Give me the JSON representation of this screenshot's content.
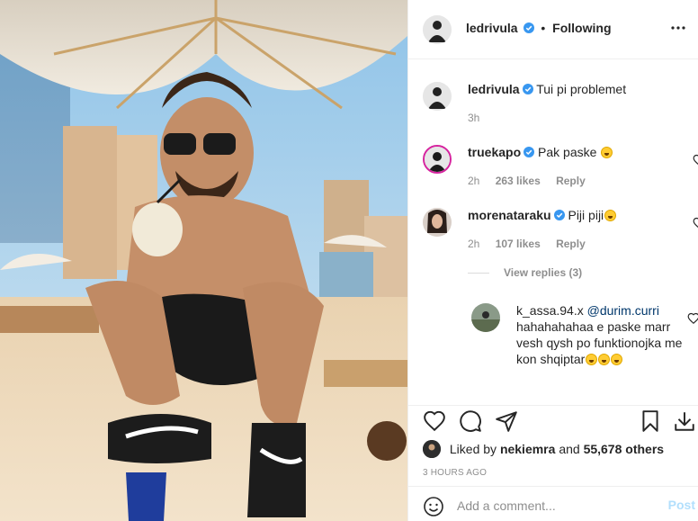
{
  "header": {
    "username": "ledrivula",
    "separator": "•",
    "follow_state": "Following"
  },
  "caption": {
    "username": "ledrivula",
    "text": "Tui pi problemet",
    "time": "3h"
  },
  "comments": [
    {
      "username": "truekapo",
      "text": "Pak paske",
      "time": "2h",
      "likes": "263 likes",
      "reply_label": "Reply"
    },
    {
      "username": "morenataraku",
      "text": "Piji piji",
      "time": "2h",
      "likes": "107 likes",
      "reply_label": "Reply"
    }
  ],
  "view_replies": "View replies (3)",
  "reply": {
    "username": "k_assa.94.x",
    "mention": "@durim.curri",
    "text": "hahahahahaa e paske marr vesh qysh po funktionojka me kon shqiptar"
  },
  "likes": {
    "prefix": "Liked by",
    "user": "nekiemra",
    "conjunction": "and",
    "count": "55,678 others"
  },
  "timestamp": "3 HOURS AGO",
  "comment_box": {
    "placeholder": "Add a comment...",
    "post_label": "Post"
  },
  "icons": [
    "more-icon",
    "verified-badge-icon",
    "heart-icon",
    "comment-icon",
    "share-icon",
    "bookmark-icon",
    "download-icon",
    "emoji-icon"
  ],
  "colors": {
    "verified": "#3897f0",
    "link": "#00376b",
    "muted": "#8e8e8e",
    "post_disabled": "#b2dffc"
  }
}
